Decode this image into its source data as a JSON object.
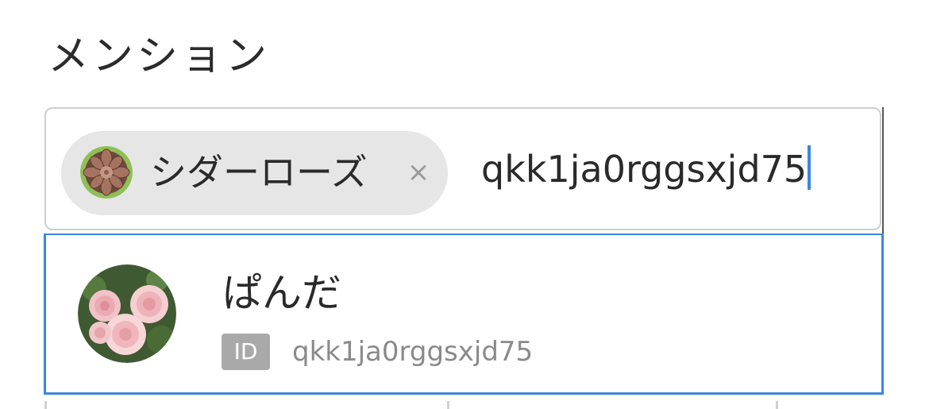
{
  "section": {
    "title": "メンション"
  },
  "mention_field": {
    "selected_chip": {
      "label": "シダーローズ",
      "avatar_icon": "succulent-avatar",
      "remove_symbol": "×"
    },
    "input_value": "qkk1ja0rggsxjd75"
  },
  "suggestions": [
    {
      "name": "ぱんだ",
      "id_badge": "ID",
      "user_id": "qkk1ja0rggsxjd75",
      "avatar_icon": "pink-roses-avatar"
    }
  ],
  "colors": {
    "accent": "#3a86e0",
    "chip_bg": "#e6e6e6",
    "badge_bg": "#a9a9a9",
    "border": "#cfcfcf"
  }
}
